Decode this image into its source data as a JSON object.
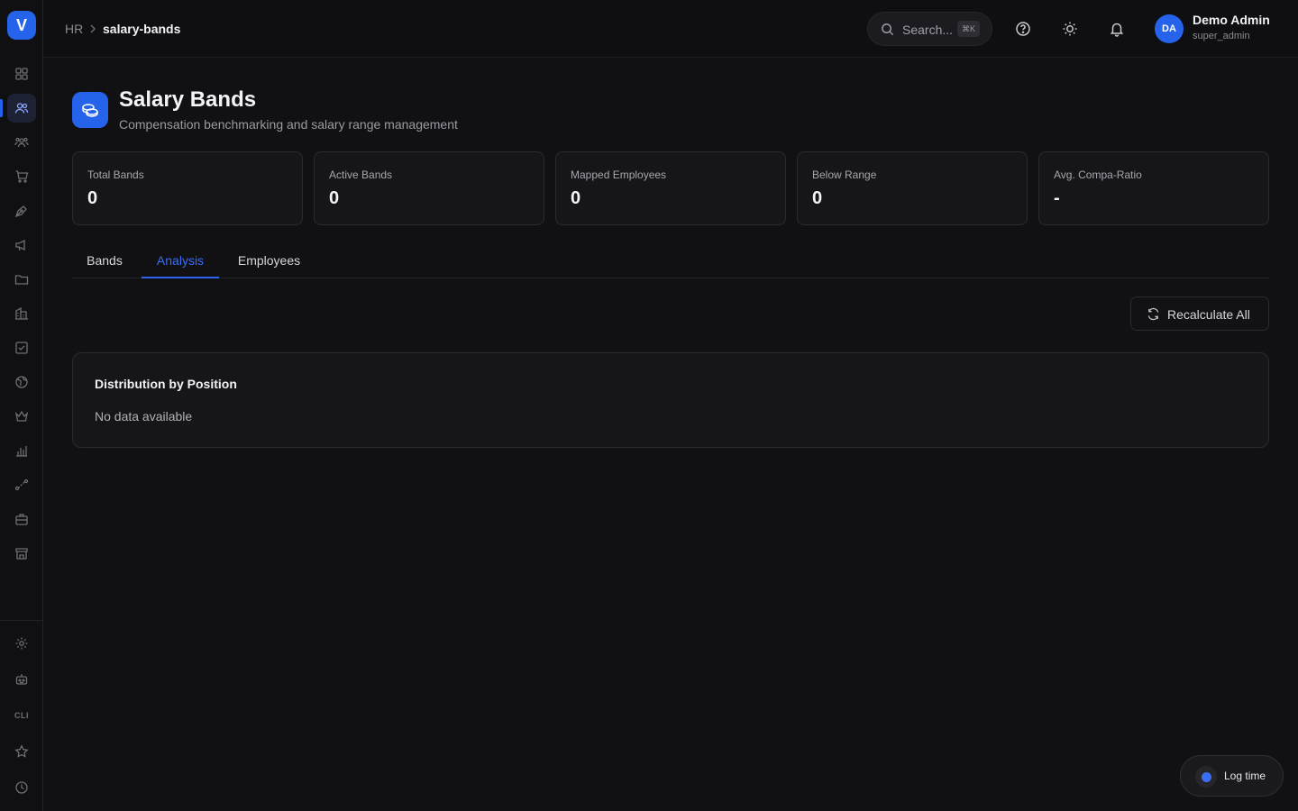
{
  "sidebar": {
    "logo": "V",
    "cli_label": "CLI",
    "items": [
      {
        "icon": "dashboard-grid-icon"
      },
      {
        "icon": "users-icon"
      },
      {
        "icon": "team-icon"
      },
      {
        "icon": "cart-icon"
      },
      {
        "icon": "pen-tool-icon"
      },
      {
        "icon": "megaphone-icon"
      },
      {
        "icon": "folder-icon"
      },
      {
        "icon": "building-icon"
      },
      {
        "icon": "checkbox-icon"
      },
      {
        "icon": "globe-icon"
      },
      {
        "icon": "crown-icon"
      },
      {
        "icon": "bar-chart-icon"
      },
      {
        "icon": "route-icon"
      },
      {
        "icon": "briefcase-icon"
      },
      {
        "icon": "store-icon"
      }
    ],
    "bottom_items": [
      {
        "icon": "settings-icon"
      },
      {
        "icon": "bot-icon"
      },
      {
        "icon": "cli-icon"
      },
      {
        "icon": "star-icon"
      },
      {
        "icon": "clock-icon"
      }
    ],
    "active_item": "users-icon"
  },
  "header": {
    "breadcrumb": {
      "root": "HR",
      "current": "salary-bands"
    },
    "search": {
      "placeholder": "Search...",
      "shortcut": "⌘K"
    },
    "user": {
      "initials": "DA",
      "name": "Demo Admin",
      "role": "super_admin"
    }
  },
  "page": {
    "title": "Salary Bands",
    "subtitle": "Compensation benchmarking and salary range management"
  },
  "stats": [
    {
      "label": "Total Bands",
      "value": "0"
    },
    {
      "label": "Active Bands",
      "value": "0"
    },
    {
      "label": "Mapped Employees",
      "value": "0"
    },
    {
      "label": "Below Range",
      "value": "0"
    },
    {
      "label": "Avg. Compa-Ratio",
      "value": "-"
    }
  ],
  "tabs": [
    {
      "label": "Bands",
      "active": false
    },
    {
      "label": "Analysis",
      "active": true
    },
    {
      "label": "Employees",
      "active": false
    }
  ],
  "actions": {
    "recalculate_label": "Recalculate All"
  },
  "panel": {
    "title": "Distribution by Position",
    "empty_text": "No data available"
  },
  "log_time": {
    "label": "Log time"
  },
  "colors": {
    "accent": "#2563eb",
    "background": "#111113",
    "card": "#161619"
  }
}
